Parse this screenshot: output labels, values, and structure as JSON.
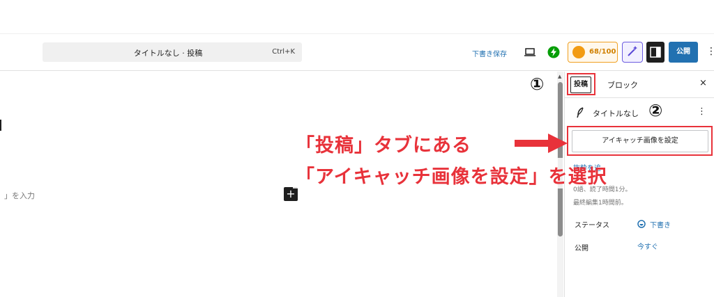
{
  "toolbar": {
    "command_text": "タイトルなし · 投稿",
    "command_shortcut": "Ctrl+K",
    "save_draft": "下書き保存",
    "score": "68/100",
    "publish": "公開"
  },
  "editor": {
    "placeholder": "」を入力",
    "add_block": "+"
  },
  "sidebar": {
    "tab_post": "投稿",
    "tab_block": "ブロック",
    "close": "×",
    "post_title": "タイトルなし",
    "featured_button": "アイキャッチ画像を設定",
    "excerpt_link": "抜粋を追",
    "meta_words": "0語、読了時間1分。",
    "meta_edited": "最終編集1時間前。",
    "rows": [
      {
        "label": "ステータス",
        "value": "下書き"
      },
      {
        "label": "公開",
        "value": "今すぐ"
      }
    ]
  },
  "annotations": {
    "num1": "①",
    "num2": "②",
    "line1": "「投稿」タブにある",
    "line2": "「アイキャッチ画像を設定」を選択",
    "color": "#e8323a"
  }
}
